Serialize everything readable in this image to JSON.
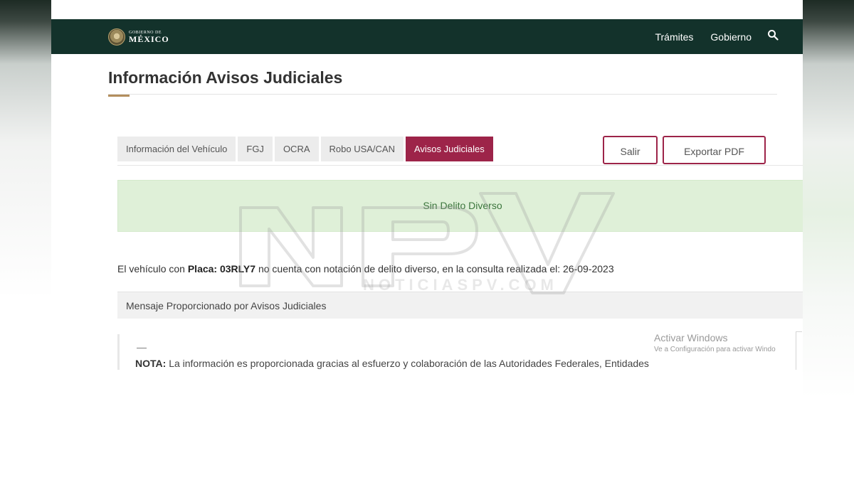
{
  "header": {
    "logo_small": "GOBIERNO DE",
    "logo_big": "MÉXICO",
    "nav": [
      "Trámites",
      "Gobierno"
    ],
    "search_icon": "search-icon",
    "bg_color": "#13322b"
  },
  "page": {
    "title": "Información Avisos Judiciales",
    "accent_color": "#b38e5d"
  },
  "tabs": [
    {
      "label": "Información del Vehículo",
      "active": false
    },
    {
      "label": "FGJ",
      "active": false
    },
    {
      "label": "OCRA",
      "active": false
    },
    {
      "label": "Robo USA/CAN",
      "active": false
    },
    {
      "label": "Avisos Judiciales",
      "active": true
    }
  ],
  "active_tab_color": "#9d2449",
  "actions": {
    "exit_label": "Salir",
    "export_label": "Exportar PDF"
  },
  "alert": {
    "text": "Sin Delito Diverso",
    "bg_color": "#dff0d8"
  },
  "result": {
    "prefix": "El vehículo con",
    "plate_label": "Placa:",
    "plate": "03RLY7",
    "suffix": "no cuenta con notación de delito diverso, en la consulta realizada el: 26-09-2023"
  },
  "panel": {
    "heading": "Mensaje Proporcionado por Avisos Judiciales",
    "dash": "—",
    "note_label": "NOTA:",
    "note_text": "La información es proporcionada gracias al esfuerzo y colaboración de las Autoridades Federales, Entidades"
  },
  "os_overlay": {
    "title": "Activar Windows",
    "subtitle": "Ve a Configuración para activar Windo"
  },
  "watermark": {
    "text": "NOTICIASPV.COM"
  }
}
